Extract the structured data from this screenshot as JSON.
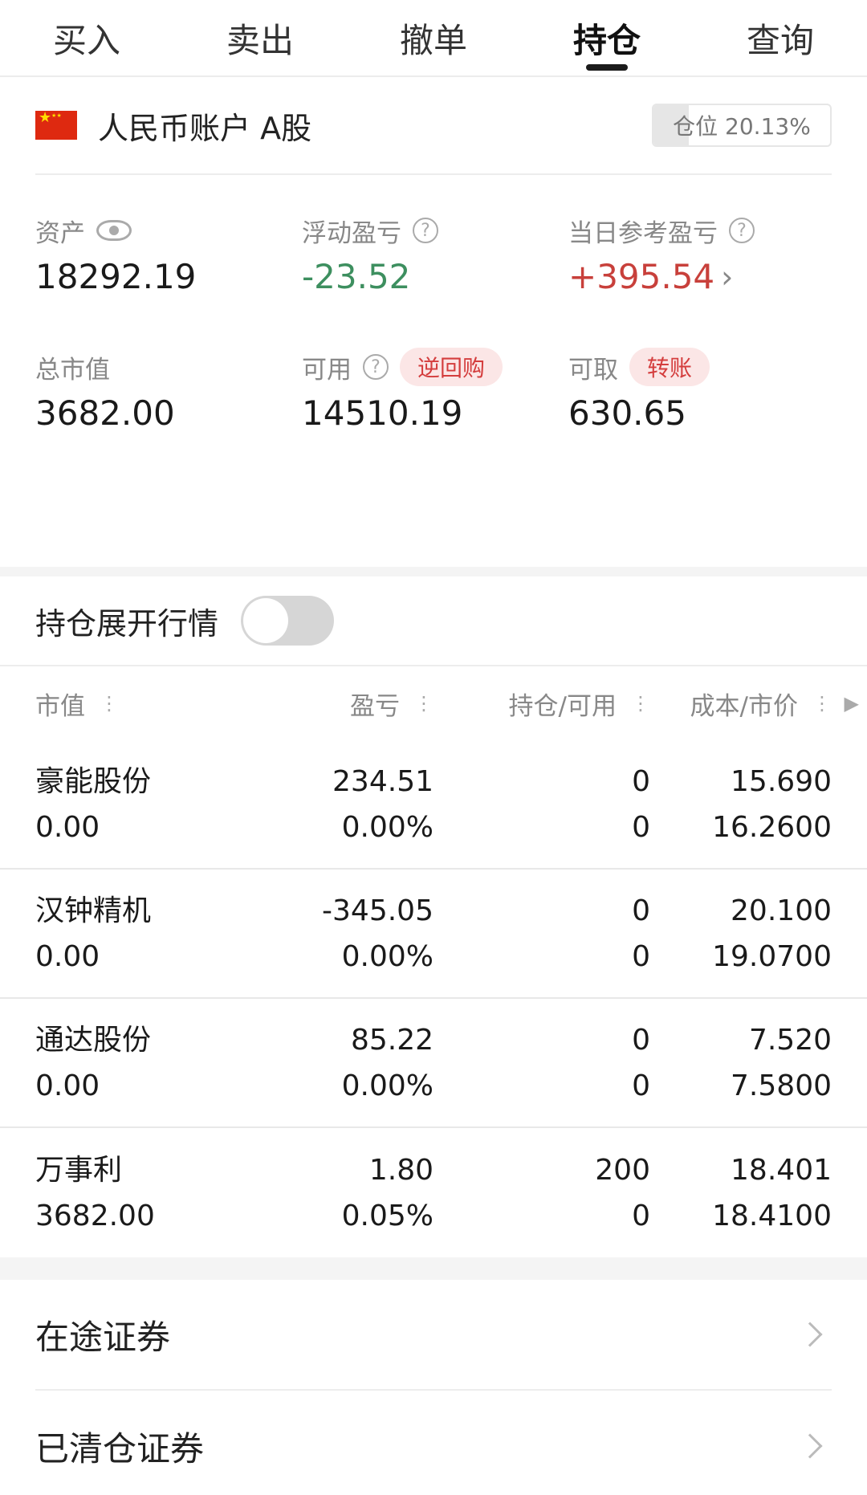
{
  "tabs": [
    {
      "label": "买入",
      "active": false
    },
    {
      "label": "卖出",
      "active": false
    },
    {
      "label": "撤单",
      "active": false
    },
    {
      "label": "持仓",
      "active": true
    },
    {
      "label": "查询",
      "active": false
    }
  ],
  "account": {
    "name": "人民币账户 A股",
    "flag_icon": "china-flag-icon",
    "position_label": "仓位 20.13%",
    "position_ratio": 0.2013
  },
  "stats": {
    "assets": {
      "label": "资产",
      "value": "18292.19"
    },
    "floating_pnl": {
      "label": "浮动盈亏",
      "value": "-23.52"
    },
    "daily_pnl": {
      "label": "当日参考盈亏",
      "value": "+395.54"
    },
    "market_value": {
      "label": "总市值",
      "value": "3682.00"
    },
    "available": {
      "label": "可用",
      "value": "14510.19",
      "badge": "逆回购"
    },
    "withdrawable": {
      "label": "可取",
      "value": "630.65",
      "badge": "转账"
    }
  },
  "toggle": {
    "label": "持仓展开行情",
    "on": false
  },
  "table": {
    "headers": [
      "市值",
      "盈亏",
      "持仓/可用",
      "成本/市价"
    ],
    "rows": [
      {
        "name": "豪能股份",
        "market_value": "0.00",
        "pnl": "234.51",
        "pnl_pct": "0.00%",
        "holding": "0",
        "available": "0",
        "cost": "15.690",
        "price": "16.2600",
        "pnl_dir": "up",
        "pct_dir": "flat"
      },
      {
        "name": "汉钟精机",
        "market_value": "0.00",
        "pnl": "-345.05",
        "pnl_pct": "0.00%",
        "holding": "0",
        "available": "0",
        "cost": "20.100",
        "price": "19.0700",
        "pnl_dir": "down",
        "pct_dir": "flat"
      },
      {
        "name": "通达股份",
        "market_value": "0.00",
        "pnl": "85.22",
        "pnl_pct": "0.00%",
        "holding": "0",
        "available": "0",
        "cost": "7.520",
        "price": "7.5800",
        "pnl_dir": "up",
        "pct_dir": "flat"
      },
      {
        "name": "万事利",
        "market_value": "3682.00",
        "pnl": "1.80",
        "pnl_pct": "0.05%",
        "holding": "200",
        "available": "0",
        "cost": "18.401",
        "price": "18.4100",
        "pnl_dir": "up",
        "pct_dir": "up"
      }
    ]
  },
  "links": [
    {
      "label": "在途证券"
    },
    {
      "label": "已清仓证券"
    }
  ],
  "colors": {
    "up": "#c8403b",
    "down": "#3d8f5f",
    "accent_badge_bg": "#fbe6e6"
  }
}
